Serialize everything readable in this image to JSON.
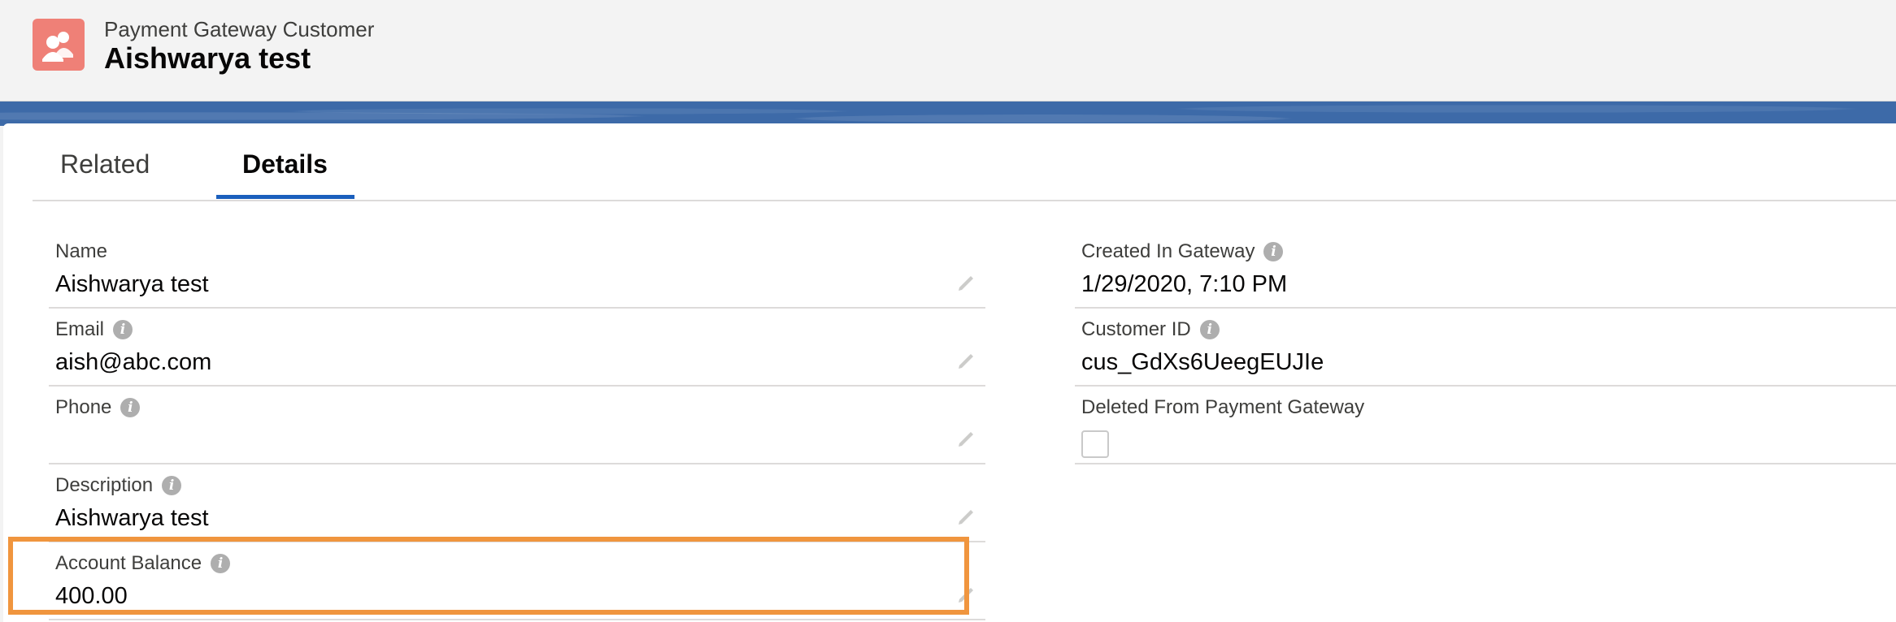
{
  "header": {
    "object_type": "Payment Gateway Customer",
    "record_name": "Aishwarya test",
    "icon": "customer-icon",
    "icon_color": "#ef8077"
  },
  "tabs": [
    {
      "label": "Related",
      "active": false
    },
    {
      "label": "Details",
      "active": true
    }
  ],
  "fields": {
    "name": {
      "label": "Name",
      "value": "Aishwarya test"
    },
    "email": {
      "label": "Email",
      "value": "aish@abc.com"
    },
    "phone": {
      "label": "Phone",
      "value": ""
    },
    "description": {
      "label": "Description",
      "value": "Aishwarya test"
    },
    "account_balance": {
      "label": "Account Balance",
      "value": "400.00"
    },
    "created_in_gateway": {
      "label": "Created In Gateway",
      "value": "1/29/2020, 7:10 PM"
    },
    "customer_id": {
      "label": "Customer ID",
      "value": "cus_GdXs6UeegEUJIe"
    },
    "deleted_from_gateway": {
      "label": "Deleted From Payment Gateway",
      "checked": false
    }
  },
  "colors": {
    "accent": "#1b5fbd",
    "highlight": "#f0953e",
    "band": "#3d6aa8"
  }
}
